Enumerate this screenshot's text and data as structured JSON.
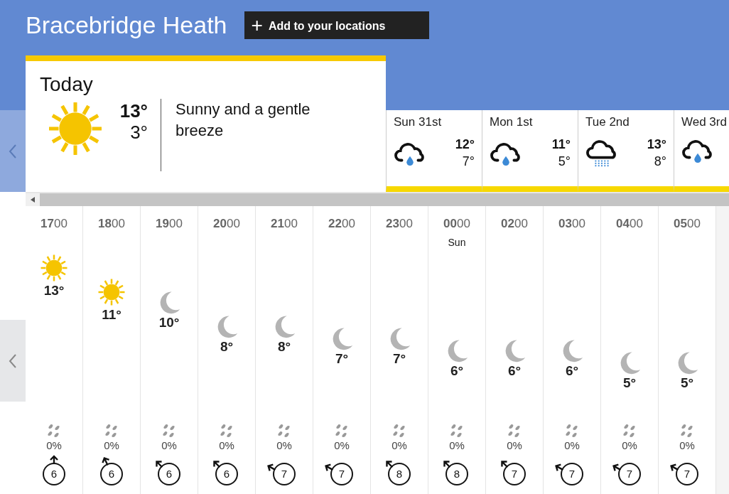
{
  "location": {
    "name": "Bracebridge Heath",
    "add_button": "Add to your locations",
    "add_icon": "+"
  },
  "today": {
    "label": "Today",
    "kind": "sun",
    "high": "13°",
    "low": "3°",
    "description": "Sunny and a gentle breeze"
  },
  "days": [
    {
      "label": "Sun 31st",
      "kind": "light_rain",
      "high": "12°",
      "low": "7°"
    },
    {
      "label": "Mon 1st",
      "kind": "light_rain",
      "high": "11°",
      "low": "5°"
    },
    {
      "label": "Tue 2nd",
      "kind": "drizzle",
      "high": "13°",
      "low": "8°"
    },
    {
      "label": "Wed 3rd",
      "kind": "light_rain"
    }
  ],
  "hours": [
    {
      "time": "**17**00",
      "kind": "sun",
      "temp": "13°",
      "precip": "0%",
      "wind": {
        "kind": "n",
        "speed": "6"
      }
    },
    {
      "time": "**18**00",
      "kind": "sun",
      "temp": "11°",
      "precip": "0%",
      "wind": {
        "kind": "nnw",
        "speed": "6"
      }
    },
    {
      "time": "**19**00",
      "kind": "moon",
      "temp": "10°",
      "precip": "0%",
      "wind": {
        "kind": "nw",
        "speed": "6"
      }
    },
    {
      "time": "**20**00",
      "kind": "moon",
      "temp": "8°",
      "precip": "0%",
      "wind": {
        "kind": "nw",
        "speed": "6"
      }
    },
    {
      "time": "**21**00",
      "kind": "moon",
      "temp": "8°",
      "precip": "0%",
      "wind": {
        "kind": "wnw",
        "speed": "7"
      }
    },
    {
      "time": "**22**00",
      "kind": "moon",
      "temp": "7°",
      "precip": "0%",
      "wind": {
        "kind": "wnw",
        "speed": "7"
      }
    },
    {
      "time": "**23**00",
      "kind": "moon",
      "temp": "7°",
      "precip": "0%",
      "wind": {
        "kind": "nw",
        "speed": "8"
      }
    },
    {
      "time": "**00**00",
      "day": "Sun",
      "kind": "moon",
      "temp": "6°",
      "precip": "0%",
      "wind": {
        "kind": "nw",
        "speed": "8"
      }
    },
    {
      "time": "**02**00",
      "kind": "moon",
      "temp": "6°",
      "precip": "0%",
      "wind": {
        "kind": "nw",
        "speed": "7"
      }
    },
    {
      "time": "**03**00",
      "kind": "moon",
      "temp": "6°",
      "precip": "0%",
      "wind": {
        "kind": "wnw",
        "speed": "7"
      }
    },
    {
      "time": "**04**00",
      "kind": "moon",
      "temp": "5°",
      "precip": "0%",
      "wind": {
        "kind": "wnw",
        "speed": "7"
      }
    },
    {
      "time": "**05**00",
      "kind": "moon",
      "temp": "5°",
      "precip": "0%",
      "wind": {
        "kind": "wnw",
        "speed": "7"
      }
    }
  ]
}
